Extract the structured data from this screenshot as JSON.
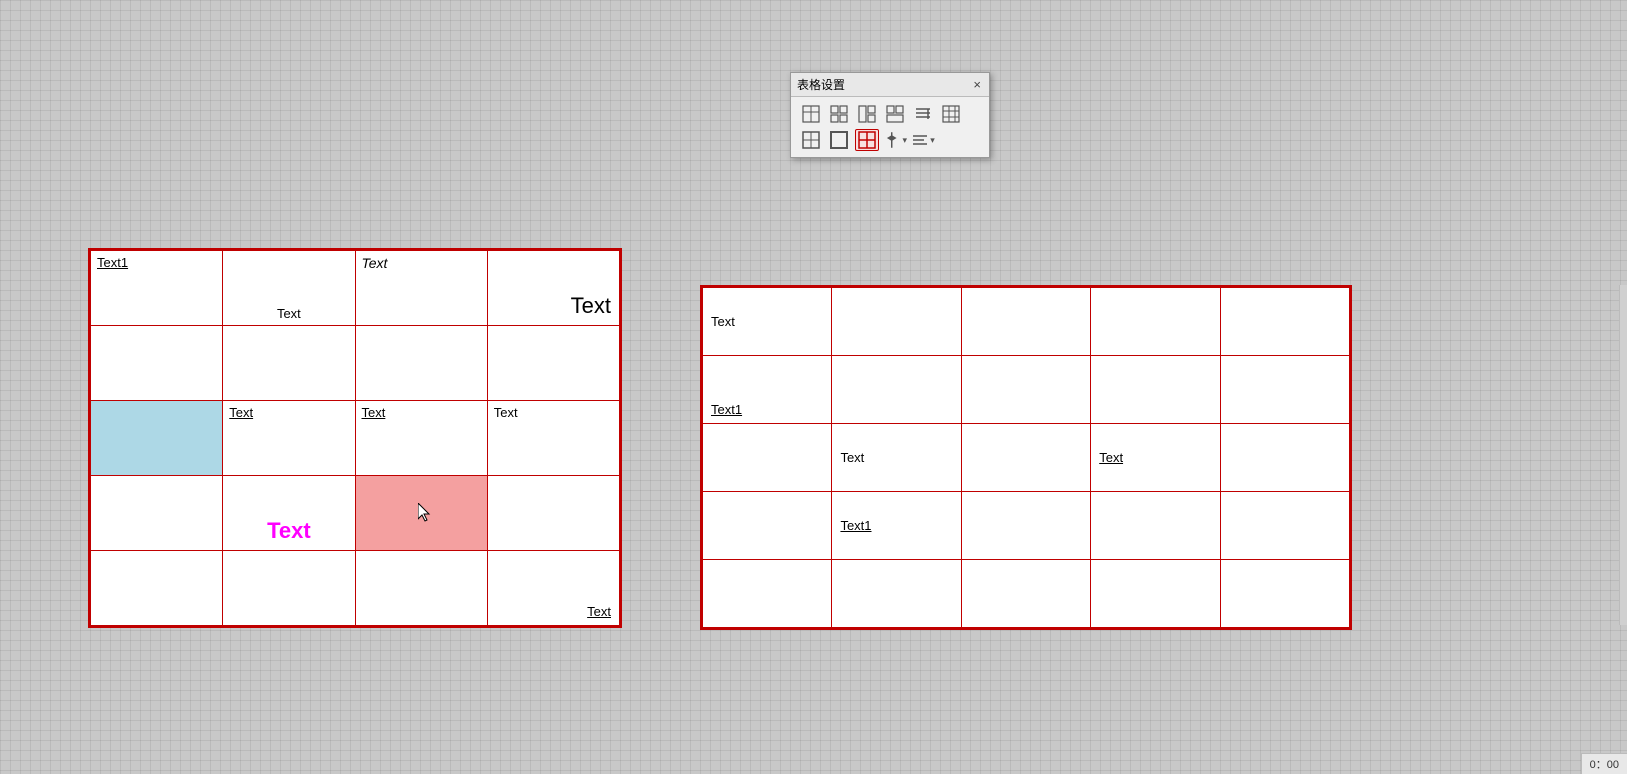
{
  "dialog": {
    "title": "表格设置",
    "close_label": "×",
    "icons_row1": [
      {
        "name": "insert-table",
        "symbol": "⊞",
        "tooltip": "插入表格"
      },
      {
        "name": "merge-cells",
        "symbol": "⊟",
        "tooltip": "合并单元格"
      },
      {
        "name": "split-cells",
        "symbol": "⊠",
        "tooltip": "拆分单元格"
      },
      {
        "name": "split-table",
        "symbol": "⊡",
        "tooltip": "拆分表格"
      },
      {
        "name": "table-style",
        "symbol": "≡",
        "tooltip": "表格样式"
      },
      {
        "name": "table-props",
        "symbol": "⊞",
        "tooltip": "表格属性"
      }
    ],
    "icons_row2": [
      {
        "name": "border-all",
        "symbol": "⊞",
        "tooltip": "全部边框"
      },
      {
        "name": "border-outer",
        "symbol": "⊡",
        "tooltip": "外部边框"
      },
      {
        "name": "border-inner",
        "symbol": "⊕",
        "tooltip": "内部边框",
        "active": true
      },
      {
        "name": "border-align",
        "symbol": "⊥",
        "tooltip": "对齐"
      },
      {
        "name": "text-align",
        "symbol": "≡",
        "tooltip": "文字对齐"
      }
    ]
  },
  "left_table": {
    "rows": [
      [
        {
          "text": "Text1",
          "underline": true,
          "style": "normal",
          "position": "top-left"
        },
        {
          "text": "",
          "style": "empty"
        },
        {
          "text": "Text",
          "italic": true,
          "style": "italic",
          "position": "top-left"
        },
        {
          "text": "Text",
          "style": "large",
          "position": "bottom-right"
        }
      ],
      [
        {
          "text": "",
          "style": "empty"
        },
        {
          "text": "",
          "style": "empty"
        },
        {
          "text": "",
          "style": "empty"
        },
        {
          "text": "",
          "style": "empty"
        }
      ],
      [
        {
          "text": "",
          "style": "empty",
          "bg": "lightblue"
        },
        {
          "text": "Text",
          "underline": true,
          "style": "normal",
          "position": "top-left"
        },
        {
          "text": "Text",
          "underline": true,
          "style": "normal",
          "position": "top-left"
        },
        {
          "text": "Text",
          "style": "normal",
          "position": "top-left"
        }
      ],
      [
        {
          "text": "",
          "style": "empty"
        },
        {
          "text": "Text",
          "style": "magenta"
        },
        {
          "text": "",
          "style": "empty",
          "bg": "pink"
        },
        {
          "text": "",
          "style": "empty"
        }
      ],
      [
        {
          "text": "",
          "style": "empty"
        },
        {
          "text": "",
          "style": "empty"
        },
        {
          "text": "",
          "style": "empty"
        },
        {
          "text": "Text",
          "underline": true,
          "style": "normal",
          "position": "bottom-right"
        }
      ]
    ],
    "row1_bottom_label": "Text"
  },
  "right_table": {
    "rows": [
      [
        {
          "text": "Text",
          "style": "normal"
        },
        {
          "text": "",
          "style": "empty"
        },
        {
          "text": "",
          "style": "empty"
        },
        {
          "text": "",
          "style": "empty"
        },
        {
          "text": "",
          "style": "empty"
        }
      ],
      [
        {
          "text": "Text1",
          "underline": true,
          "style": "normal",
          "position": "bottom-left"
        },
        {
          "text": "",
          "style": "empty"
        },
        {
          "text": "",
          "style": "empty"
        },
        {
          "text": "",
          "style": "empty"
        },
        {
          "text": "",
          "style": "empty"
        }
      ],
      [
        {
          "text": "",
          "style": "empty"
        },
        {
          "text": "Text",
          "style": "normal"
        },
        {
          "text": "",
          "style": "empty"
        },
        {
          "text": "Text",
          "underline": true,
          "style": "normal"
        },
        {
          "text": "",
          "style": "empty"
        }
      ],
      [
        {
          "text": "",
          "style": "empty"
        },
        {
          "text": "Text1",
          "underline": true,
          "style": "normal"
        },
        {
          "text": "",
          "style": "empty"
        },
        {
          "text": "",
          "style": "empty"
        },
        {
          "text": "",
          "style": "empty"
        }
      ],
      [
        {
          "text": "",
          "style": "empty"
        },
        {
          "text": "",
          "style": "empty"
        },
        {
          "text": "",
          "style": "empty"
        },
        {
          "text": "",
          "style": "empty"
        },
        {
          "text": "",
          "style": "empty"
        }
      ]
    ]
  },
  "status_bar": {
    "time": "0：00"
  }
}
